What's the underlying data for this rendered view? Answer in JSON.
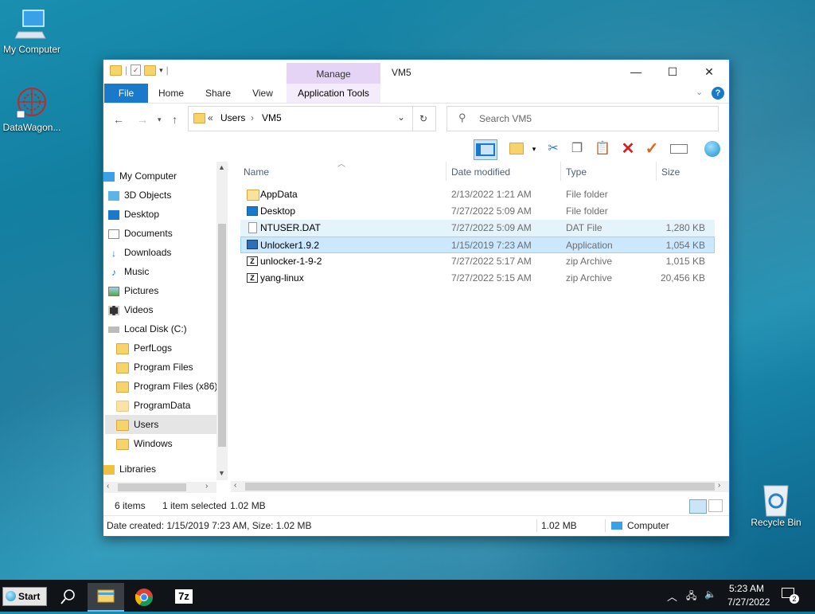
{
  "desktop": {
    "icons": [
      {
        "label": "My Computer",
        "icon": "computer-icon"
      },
      {
        "label": "DataWagon...",
        "icon": "datawagon-icon"
      },
      {
        "label": "Recycle Bin",
        "icon": "recycle-bin-icon"
      }
    ]
  },
  "window": {
    "title": "VM5",
    "manage_tab": "Manage",
    "ribbon_tabs": [
      "File",
      "Home",
      "Share",
      "View",
      "Application Tools"
    ],
    "address": {
      "root_chevron": "«",
      "parts": [
        "Users",
        "VM5"
      ]
    },
    "search_placeholder": "Search VM5",
    "controls": {
      "minimize": "—",
      "maximize": "☐",
      "close": "✕"
    }
  },
  "nav_pane": {
    "items": [
      {
        "label": "My Computer",
        "icon": "computer-icon"
      },
      {
        "label": "3D Objects",
        "icon": "cube-icon"
      },
      {
        "label": "Desktop",
        "icon": "desktop-icon"
      },
      {
        "label": "Documents",
        "icon": "document-icon"
      },
      {
        "label": "Downloads",
        "icon": "download-arrow-icon"
      },
      {
        "label": "Music",
        "icon": "music-note-icon"
      },
      {
        "label": "Pictures",
        "icon": "picture-icon"
      },
      {
        "label": "Videos",
        "icon": "film-icon"
      },
      {
        "label": "Local Disk (C:)",
        "icon": "drive-icon"
      },
      {
        "label": "PerfLogs",
        "icon": "folder-icon"
      },
      {
        "label": "Program Files",
        "icon": "folder-icon"
      },
      {
        "label": "Program Files (x86)",
        "icon": "folder-icon"
      },
      {
        "label": "ProgramData",
        "icon": "folder-icon"
      },
      {
        "label": "Users",
        "icon": "folder-icon",
        "selected": true
      },
      {
        "label": "Windows",
        "icon": "folder-icon"
      },
      {
        "label": "Libraries",
        "icon": "library-icon"
      }
    ]
  },
  "file_list": {
    "columns": [
      "Name",
      "Date modified",
      "Type",
      "Size"
    ],
    "rows": [
      {
        "name": "AppData",
        "date": "2/13/2022 1:21 AM",
        "type": "File folder",
        "size": "",
        "icon": "folder-icon"
      },
      {
        "name": "Desktop",
        "date": "7/27/2022 5:09 AM",
        "type": "File folder",
        "size": "",
        "icon": "desktop-icon"
      },
      {
        "name": "NTUSER.DAT",
        "date": "7/27/2022 5:09 AM",
        "type": "DAT File",
        "size": "1,280 KB",
        "icon": "file-icon"
      },
      {
        "name": "Unlocker1.9.2",
        "date": "1/15/2019 7:23 AM",
        "type": "Application",
        "size": "1,054 KB",
        "icon": "application-icon"
      },
      {
        "name": "unlocker-1-9-2",
        "date": "7/27/2022 5:17 AM",
        "type": "zip Archive",
        "size": "1,015 KB",
        "icon": "zip-icon"
      },
      {
        "name": "yang-linux",
        "date": "7/27/2022 5:15 AM",
        "type": "zip Archive",
        "size": "20,456 KB",
        "icon": "zip-icon"
      }
    ]
  },
  "status": {
    "item_count": "6 items",
    "selected": "1 item selected",
    "selected_size": "1.02 MB"
  },
  "details": {
    "text": "Date created: 1/15/2019 7:23 AM, Size: 1.02 MB",
    "size": "1.02 MB",
    "location": "Computer"
  },
  "taskbar": {
    "start_label": "Start",
    "time": "5:23 AM",
    "date": "7/27/2022",
    "notification_count": "2",
    "apps": [
      "search-icon",
      "file-explorer-icon",
      "chrome-icon",
      "7zip-icon"
    ],
    "seven_zip_label": "7z"
  }
}
